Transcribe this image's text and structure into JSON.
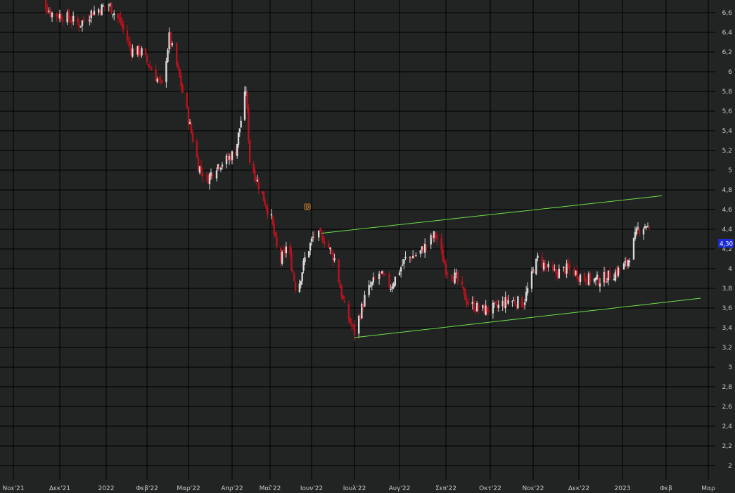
{
  "chart_data": {
    "type": "candlestick",
    "grid": true,
    "colors": {
      "background": "#212423",
      "grid": "#000000",
      "up": "#d9d9d9",
      "down": "#b8121d",
      "trendline": "#6fe04a",
      "price_badge": "#1b2bd6",
      "marker": "#c77a2a"
    },
    "ylim": [
      1.9,
      6.72
    ],
    "y_ticks": [
      "2",
      "2,2",
      "2,4",
      "2,6",
      "2,8",
      "3",
      "3,2",
      "3,4",
      "3,6",
      "3,8",
      "4",
      "4,2",
      "4,4",
      "4,6",
      "4,8",
      "5",
      "5,2",
      "5,4",
      "5,6",
      "5,8",
      "6",
      "6,2",
      "6,4",
      "6,6"
    ],
    "x_ticks": [
      "Noε'21",
      "Δεκ'21",
      "2022",
      "Φεβ'22",
      "Μαρ'22",
      "Απρ'22",
      "Μαϊ'22",
      "Ιουν'22",
      "Ιουλ'22",
      "Αυγ'22",
      "Σεπ'22",
      "Οκτ'22",
      "Noε'22",
      "Δεκ'22",
      "2023",
      "Φεβ",
      "Μαρ"
    ],
    "last_price": "4,30",
    "event_marker": "D",
    "trendlines": [
      {
        "name": "upper-channel",
        "from": [
          "2022-06-08",
          4.36
        ],
        "to": [
          "2023-01-29",
          4.74
        ]
      },
      {
        "name": "lower-channel",
        "from": [
          "2022-07-01",
          3.3
        ],
        "to": [
          "2023-02-24",
          3.7
        ]
      }
    ],
    "close_path": [
      [
        "2021-11-15",
        6.85
      ],
      [
        "2021-11-25",
        6.6
      ],
      [
        "2021-12-06",
        6.55
      ],
      [
        "2021-12-14",
        6.48
      ],
      [
        "2021-12-22",
        6.6
      ],
      [
        "2022-01-03",
        6.68
      ],
      [
        "2022-01-12",
        6.5
      ],
      [
        "2022-01-20",
        6.22
      ],
      [
        "2022-01-28",
        6.2
      ],
      [
        "2022-02-05",
        6.0
      ],
      [
        "2022-02-11",
        5.85
      ],
      [
        "2022-02-16",
        6.35
      ],
      [
        "2022-02-22",
        6.0
      ],
      [
        "2022-03-02",
        5.45
      ],
      [
        "2022-03-08",
        5.05
      ],
      [
        "2022-03-14",
        4.9
      ],
      [
        "2022-03-21",
        5.05
      ],
      [
        "2022-03-28",
        5.1
      ],
      [
        "2022-04-04",
        5.2
      ],
      [
        "2022-04-12",
        5.82
      ],
      [
        "2022-04-15",
        5.1
      ],
      [
        "2022-04-22",
        4.85
      ],
      [
        "2022-05-02",
        4.5
      ],
      [
        "2022-05-08",
        4.05
      ],
      [
        "2022-05-14",
        4.25
      ],
      [
        "2022-05-21",
        3.75
      ],
      [
        "2022-05-27",
        4.1
      ],
      [
        "2022-06-03",
        4.35
      ],
      [
        "2022-06-10",
        4.3
      ],
      [
        "2022-06-17",
        4.1
      ],
      [
        "2022-06-24",
        3.6
      ],
      [
        "2022-07-01",
        3.35
      ],
      [
        "2022-07-09",
        3.75
      ],
      [
        "2022-07-18",
        3.95
      ],
      [
        "2022-07-26",
        3.82
      ],
      [
        "2022-08-05",
        4.1
      ],
      [
        "2022-08-14",
        4.15
      ],
      [
        "2022-08-25",
        4.35
      ],
      [
        "2022-09-01",
        4.0
      ],
      [
        "2022-09-08",
        3.9
      ],
      [
        "2022-09-16",
        3.65
      ],
      [
        "2022-09-25",
        3.58
      ],
      [
        "2022-10-05",
        3.6
      ],
      [
        "2022-10-14",
        3.68
      ],
      [
        "2022-10-25",
        3.65
      ],
      [
        "2022-11-04",
        4.1
      ],
      [
        "2022-11-14",
        3.95
      ],
      [
        "2022-11-24",
        4.0
      ],
      [
        "2022-12-05",
        3.9
      ],
      [
        "2022-12-15",
        3.88
      ],
      [
        "2022-12-26",
        3.95
      ],
      [
        "2023-01-04",
        4.05
      ],
      [
        "2023-01-12",
        4.4
      ],
      [
        "2023-01-18",
        4.45
      ],
      [
        "2023-01-22",
        4.3
      ]
    ]
  }
}
